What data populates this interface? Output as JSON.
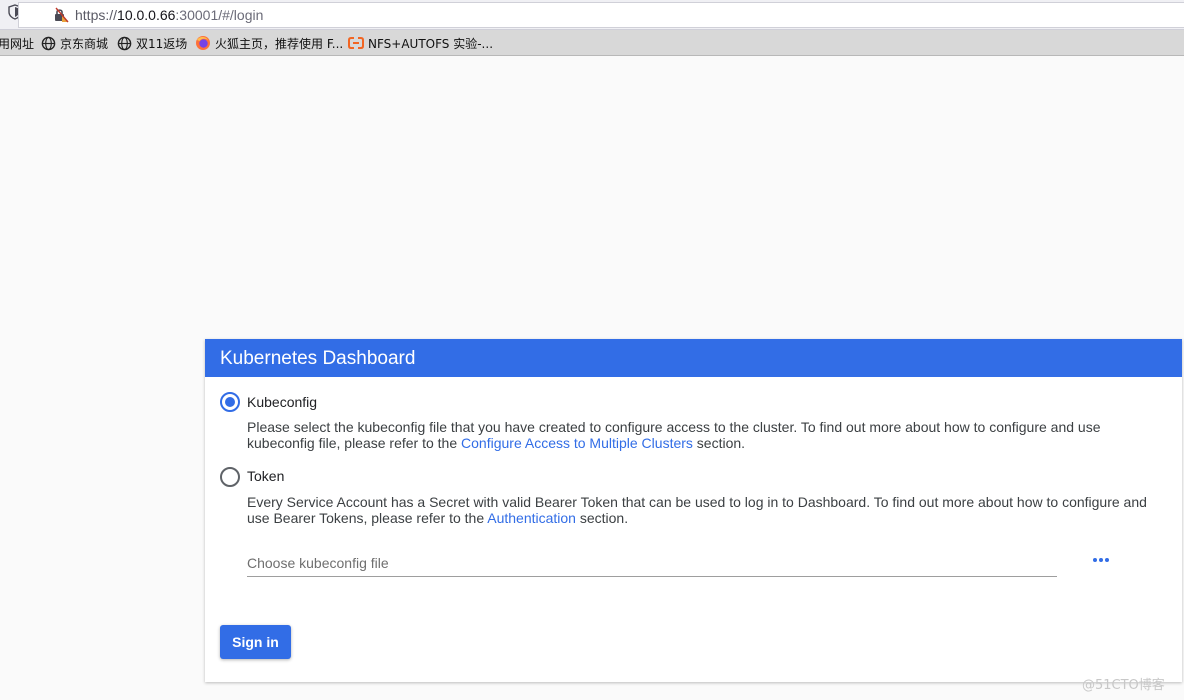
{
  "browser": {
    "url_prefix": "https://",
    "url_host": "10.0.0.66",
    "url_rest": ":30001/#/login",
    "bookmarks": [
      {
        "label": "用网址",
        "icon": "none"
      },
      {
        "label": "京东商城",
        "icon": "globe-icon"
      },
      {
        "label": "双11返场",
        "icon": "globe-icon"
      },
      {
        "label": "火狐主页，推荐使用 F...",
        "icon": "firefox-icon"
      },
      {
        "label": "NFS+AUTOFS 实验-...",
        "icon": "csdn-icon"
      }
    ]
  },
  "dashboard": {
    "title": "Kubernetes Dashboard",
    "kubeconfig": {
      "label": "Kubeconfig",
      "selected": true,
      "desc_pre": "Please select the kubeconfig file that you have created to configure access to the cluster. To find out more about how to configure and use kubeconfig file, please refer to the ",
      "link": "Configure Access to Multiple Clusters",
      "desc_post": " section."
    },
    "token": {
      "label": "Token",
      "selected": false,
      "desc_pre": "Every Service Account has a Secret with valid Bearer Token that can be used to log in to Dashboard. To find out more about how to configure and use Bearer Tokens, please refer to the ",
      "link": "Authentication",
      "desc_post": " section."
    },
    "file_placeholder": "Choose kubeconfig file",
    "signin_label": "Sign in"
  },
  "watermark": "@51CTO博客",
  "colors": {
    "accent": "#326de6"
  }
}
